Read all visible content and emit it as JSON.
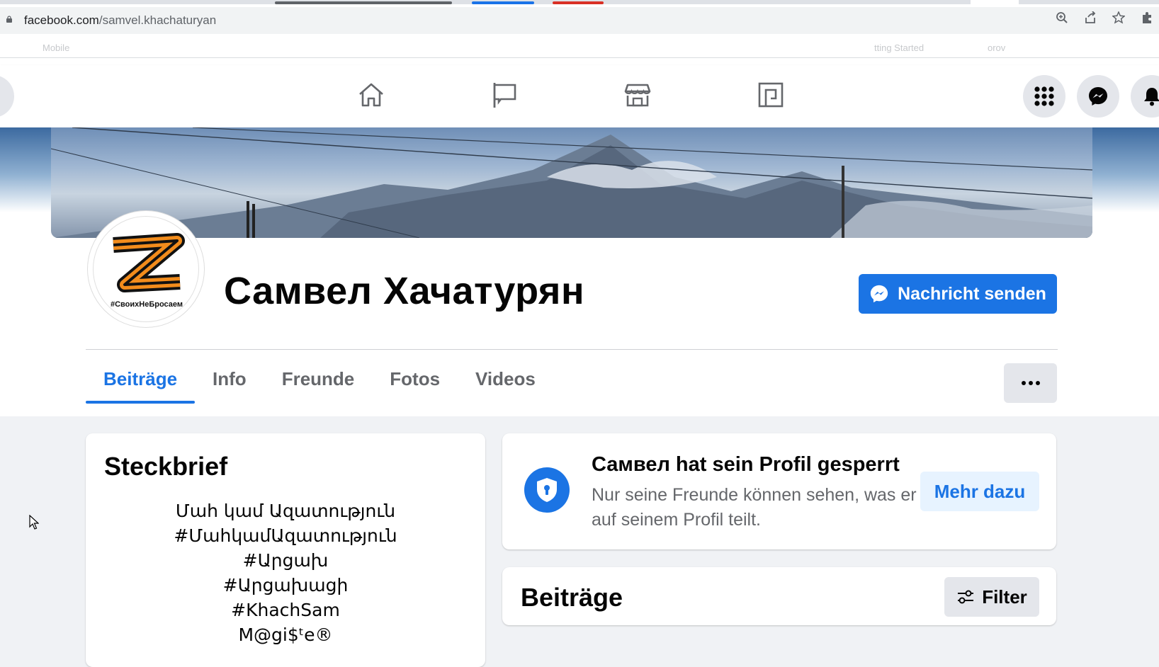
{
  "browser": {
    "url_host": "facebook.com",
    "url_path": "/samvel.khachaturyan",
    "bookmarks": [
      "Mobile",
      "tting Started",
      "orov"
    ]
  },
  "colors": {
    "facebook_blue": "#1b74e4",
    "text_primary": "#050505",
    "text_secondary": "#65676b",
    "page_bg": "#f0f2f5"
  },
  "navigation": {
    "icons": [
      "home-icon",
      "pages-flag-icon",
      "marketplace-icon",
      "gaming-icon"
    ],
    "right_icons": [
      "menu-grid-icon",
      "messenger-icon",
      "notifications-bell-icon"
    ]
  },
  "profile": {
    "name": "Самвел Хачатурян",
    "avatar_caption": "#СвоихНеБросаем",
    "message_button": "Nachricht senden"
  },
  "tabs": [
    {
      "label": "Beiträge",
      "active": true
    },
    {
      "label": "Info",
      "active": false
    },
    {
      "label": "Freunde",
      "active": false
    },
    {
      "label": "Fotos",
      "active": false
    },
    {
      "label": "Videos",
      "active": false
    }
  ],
  "intro": {
    "title": "Steckbrief",
    "bio_lines": [
      "Մահ կամ Ազատություն",
      "#ՄահկամԱզատություն",
      "#Արցախ",
      "#Արցախացի",
      "#KhachSam",
      "M@gi$ᵗe®"
    ]
  },
  "locked": {
    "title": "Самвел hat sein Profil gesperrt",
    "description": "Nur seine Freunde können sehen, was er auf seinem Profil teilt.",
    "button": "Mehr dazu"
  },
  "posts": {
    "title": "Beiträge",
    "filter_button": "Filter"
  }
}
